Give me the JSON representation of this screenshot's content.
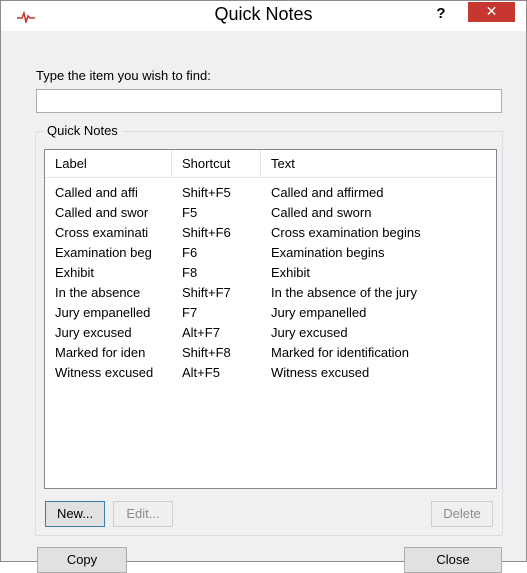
{
  "window": {
    "title": "Quick Notes",
    "help_label": "?",
    "close_label": "✕",
    "accent_color": "#c7372f"
  },
  "find": {
    "label": "Type the item you wish to find:",
    "value": "",
    "placeholder": ""
  },
  "group": {
    "label": "Quick Notes"
  },
  "list": {
    "columns": [
      "Label",
      "Shortcut",
      "Text"
    ],
    "rows": [
      {
        "label": "Called and affi",
        "shortcut": "Shift+F5",
        "text": "Called and affirmed"
      },
      {
        "label": "Called and swor",
        "shortcut": "F5",
        "text": "Called and sworn"
      },
      {
        "label": "Cross examinati",
        "shortcut": "Shift+F6",
        "text": "Cross examination begins"
      },
      {
        "label": "Examination beg",
        "shortcut": "F6",
        "text": "Examination begins"
      },
      {
        "label": "Exhibit",
        "shortcut": "F8",
        "text": "Exhibit"
      },
      {
        "label": "In the absence",
        "shortcut": "Shift+F7",
        "text": "In the absence of the jury"
      },
      {
        "label": "Jury empanelled",
        "shortcut": "F7",
        "text": "Jury empanelled"
      },
      {
        "label": "Jury excused",
        "shortcut": "Alt+F7",
        "text": "Jury excused"
      },
      {
        "label": "Marked for iden",
        "shortcut": "Shift+F8",
        "text": "Marked for identification"
      },
      {
        "label": "Witness excused",
        "shortcut": "Alt+F5",
        "text": "Witness excused"
      }
    ]
  },
  "buttons": {
    "new": "New...",
    "edit": "Edit...",
    "delete": "Delete",
    "copy": "Copy",
    "close": "Close"
  }
}
